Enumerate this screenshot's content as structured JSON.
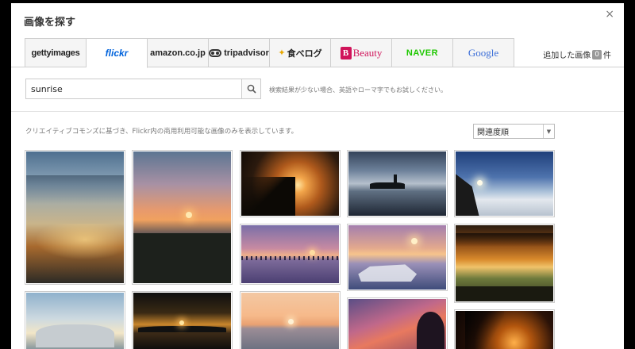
{
  "dialog": {
    "title": "画像を探す",
    "close_glyph": "×"
  },
  "tabs": [
    {
      "label": "gettyimages",
      "active": false
    },
    {
      "label": "flickr",
      "active": true
    },
    {
      "label": "amazon.co.jp",
      "active": false
    },
    {
      "label": "tripadvisor",
      "active": false
    },
    {
      "label": "食べログ",
      "active": false
    },
    {
      "label": "Beauty",
      "active": false
    },
    {
      "label": "NAVER",
      "active": false
    },
    {
      "label": "Google",
      "active": false
    }
  ],
  "added_images": {
    "prefix": "追加した画像",
    "count": "0",
    "suffix": "件"
  },
  "search": {
    "value": "sunrise",
    "hint": "検索結果が少ない場合、英語やローマ字でもお試しください。"
  },
  "notice": "クリエイティブコモンズに基づき、Flickr内の商用利用可能な画像のみを表示しています。",
  "sort": {
    "selected": "関連度順"
  },
  "colors": {
    "flickr_blue": "#0063dc",
    "naver_green": "#1ec800",
    "beauty_pink": "#d0145a"
  },
  "icons": {
    "search": "magnifier-icon",
    "close": "close-icon",
    "dropdown": "chevron-down-icon"
  }
}
